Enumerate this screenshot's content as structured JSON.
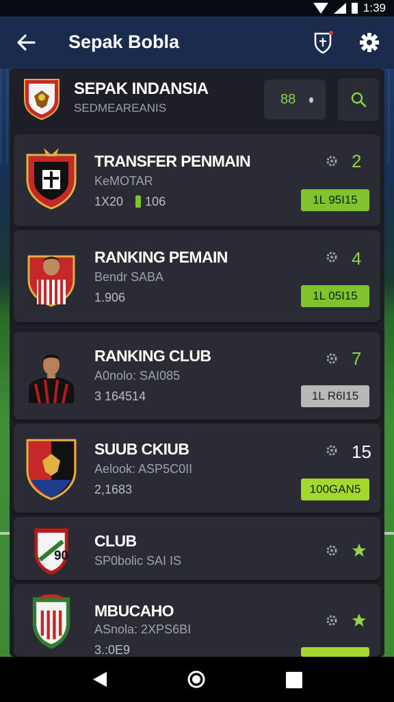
{
  "status_bar": {
    "time": "1:39"
  },
  "app_bar": {
    "title": "Sepak Bobla"
  },
  "header": {
    "title": "SEPAK INDANSIA",
    "subtitle": "SEDMEAREANIS",
    "counter_value": "88"
  },
  "cards": [
    {
      "title": "TRANSFER PENMAIN",
      "subtitle": "KeMOTAR",
      "number": "1X20",
      "number2": "106",
      "count": "2",
      "badge": "1L 95I15",
      "badge_style": "green"
    },
    {
      "title": "RANKING PEMAIN",
      "subtitle": "Bendr SABA",
      "number": "1.906",
      "count": "4",
      "badge": "1L 05I15",
      "badge_style": "green"
    },
    {
      "title": "RANKING CLUB",
      "subtitle": "A0nolo: SAI085",
      "number": "3 164514",
      "count": "7",
      "badge": "1L R6I15",
      "badge_style": "gray"
    },
    {
      "title": "SUUB CKIUB",
      "subtitle": "Aelook: ASP5C0II",
      "number": "2,1683",
      "count": "15",
      "badge": "100GAN5",
      "badge_style": "lime"
    },
    {
      "title": "CLUB",
      "subtitle": "SP0bolic SAI IS"
    },
    {
      "title": "MBUCAHO",
      "subtitle": "ASnola: 2XPS6BI",
      "number": "3.:0E9"
    }
  ],
  "colors": {
    "accent_green": "#8fd34a",
    "app_bar": "#1a2b4d",
    "card": "#2b2c33"
  },
  "icons": [
    "back-arrow-icon",
    "shield-icon",
    "gear-icon",
    "search-icon",
    "star-icon",
    "crest-icon",
    "player-photo-icon"
  ]
}
